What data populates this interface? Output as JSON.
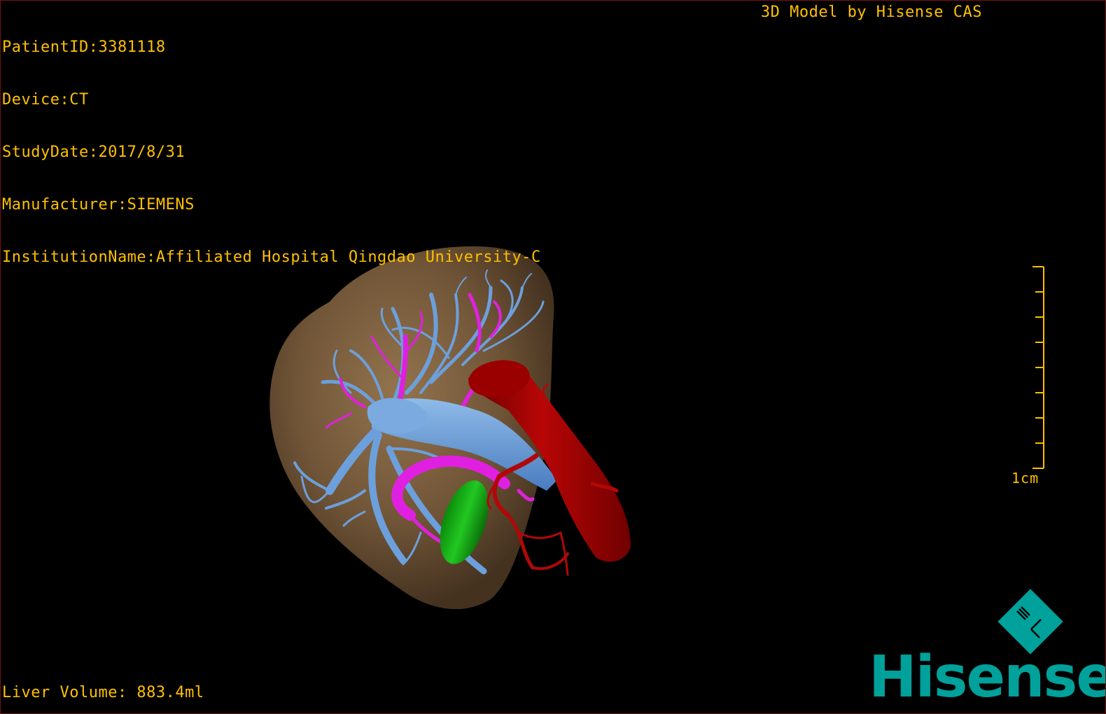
{
  "viewer": {
    "patient_id": "PatientID:3381118",
    "device": "Device:CT",
    "study_date": "StudyDate:2017/8/31",
    "manufacturer": "Manufacturer:SIEMENS",
    "institution": "InstitutionName:Affiliated Hospital Qingdao University-C",
    "brand_caption": "3D Model by Hisense CAS",
    "liver_volume": "Liver Volume: 883.4ml"
  },
  "scale": {
    "label": "1cm",
    "tick_count": 8
  },
  "logo": {
    "word": "Hisense",
    "brand_color": "#00a19a"
  },
  "model": {
    "structures": [
      {
        "name": "liver",
        "color": "#8a6a45"
      },
      {
        "name": "portal-vein",
        "color": "#6ca0dc"
      },
      {
        "name": "hepatic-artery-branches",
        "color": "#e020e0"
      },
      {
        "name": "inferior-vena-cava",
        "color": "#a00000"
      },
      {
        "name": "gallbladder",
        "color": "#10b010"
      }
    ]
  },
  "colors": {
    "overlay_text": "#ffc000",
    "frame": "#7a1010",
    "background": "#000000"
  }
}
